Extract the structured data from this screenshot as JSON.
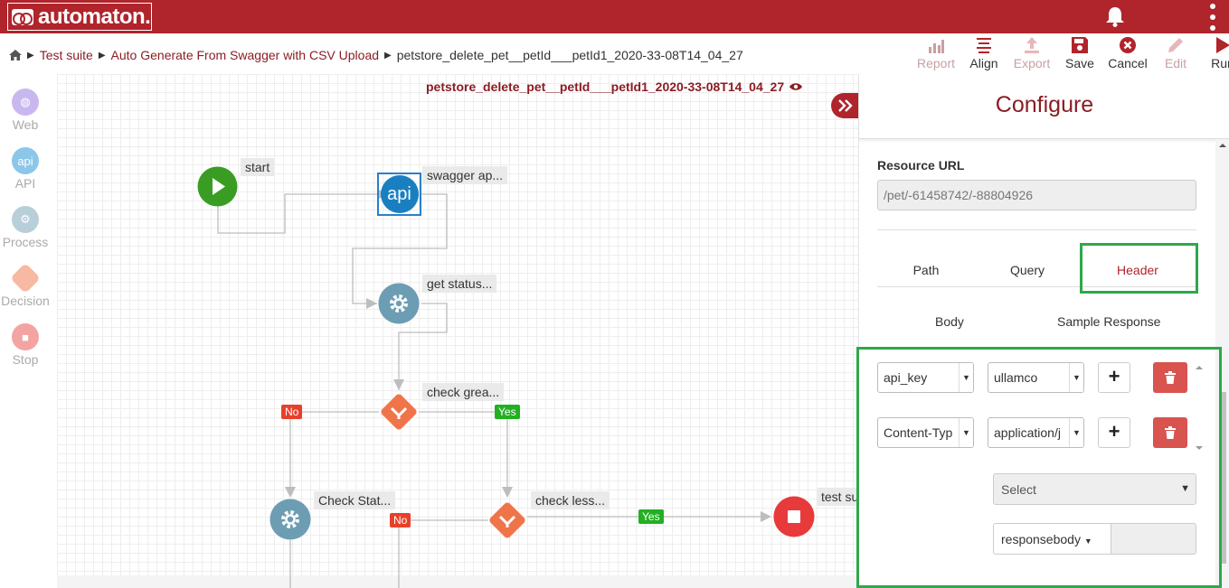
{
  "app": {
    "name": "automaton."
  },
  "breadcrumb": {
    "items": [
      "Test suite",
      "Auto Generate From Swagger with CSV Upload"
    ],
    "current": "petstore_delete_pet__petId___petId1_2020-33-08T14_04_27"
  },
  "toolbar": {
    "report": "Report",
    "align": "Align",
    "export": "Export",
    "save": "Save",
    "cancel": "Cancel",
    "edit": "Edit",
    "run": "Run"
  },
  "canvas": {
    "title": "petstore_delete_pet__petId___petId1_2020-33-08T14_04_27"
  },
  "palette": {
    "web": "Web",
    "api_icon": "api",
    "api": "API",
    "process": "Process",
    "decision": "Decision",
    "stop": "Stop"
  },
  "flow": {
    "start": "start",
    "swagger": "swagger ap...",
    "api_icon": "api",
    "get_status": "get status...",
    "check_greater": "check grea...",
    "check_status": "Check Stat...",
    "check_less": "check less...",
    "test_suite": "test su",
    "no": "No",
    "yes": "Yes"
  },
  "colors": {
    "brand": "#b0242b",
    "api_node": "#1a7fc1",
    "start_node": "#3a9d23",
    "process_node": "#6d9db3",
    "decision_node": "#f0744a",
    "stop_node": "#e83a3a",
    "highlight": "#2ea84b"
  },
  "configure": {
    "title": "Configure",
    "resource_url_label": "Resource URL",
    "resource_url": "/pet/-61458742/-88804926",
    "tabs": [
      "Path",
      "Query",
      "Header"
    ],
    "tabs2": [
      "Body",
      "Sample Response"
    ],
    "active_tab": "Header",
    "headers": [
      {
        "key": "api_key",
        "value": "ullamco"
      },
      {
        "key": "Content-Typ",
        "value": "application/j"
      }
    ],
    "select_placeholder": "Select",
    "dropdown": "responsebody"
  }
}
